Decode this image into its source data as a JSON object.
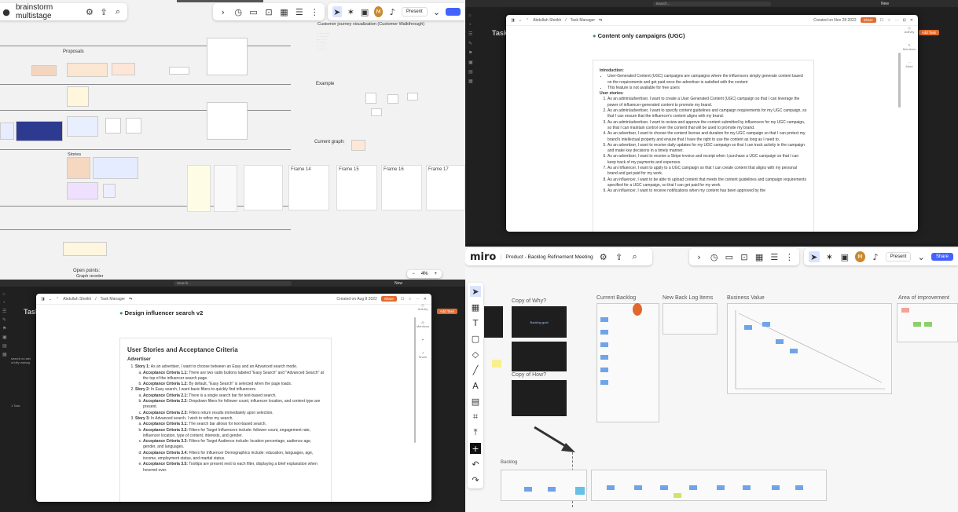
{
  "q1": {
    "board_name": "brainstorm multistage",
    "present_label": "Present",
    "zoom_level": "4%",
    "headings": {
      "proposals": "Proposals",
      "cj_title": "Customer journey visualization (Customer Walkthrough)",
      "example": "Example",
      "current_graph": "Current graph:",
      "open_points": "Open points:",
      "open_points_item": "Graph reorder",
      "stories": "Stories"
    },
    "frames": [
      "Frame 14",
      "Frame 15",
      "Frame 16",
      "Frame 17"
    ],
    "avatar": "M"
  },
  "q2": {
    "search_placeholder": "Search...",
    "new_label": "New",
    "breadcrumb_user": "Abdullah Sheikh",
    "breadcrumb_page": "Task Manager",
    "created": "Created on Nov 28 2022",
    "share": "Share",
    "page_title": "Content only campaigns (UGC)",
    "bg_text": "Task",
    "add_task": "Add Task",
    "intro_heading": "Introduction:",
    "intro_items": [
      "User-Generated Content (UGC) campaigns are campaigns where the influencers simply generate content based on the requirements and get paid once the advertiser is satisfied with the content",
      "This feature is not available for free users"
    ],
    "stories_heading": "User stories:",
    "stories": [
      "As an admin/advertiser, I want to create a User Generated Content (UGC) campaign so that I can leverage the power of influencer-generated content to promote my brand.",
      "As an admin/advertiser, I want to specify content guidelines and campaign requirements for my UGC campaign, so that I can ensure that the influencer's content aligns with my brand.",
      "As an admin/advertiser, I want to review and approve the content submitted by influencers for my UGC campaign, so that I can maintain control over the content that will be used to promote my brand.",
      "As an advertiser, I want to choose the content license and duration for my UGC campaign so that I can protect my brand's intellectual property and ensure that I have the right to use the content as long as I need to.",
      "As an advertiser, I want to receive daily updates for my UGC campaign so that I can track activity in the campaign and make key decisions in a timely manner.",
      "As an advertiser, I want to receive a Stripe invoice and receipt when I purchase a UGC campaign so that I can keep track of my payments and expenses.",
      "As an Influencer, I want to apply to a UGC campaign so that I can create content that aligns with my personal brand and get paid for my work.",
      "As an influencer, I want to be able to upload content that meets the content guidelines and campaign requirements specified for a UGC campaign, so that I can get paid for my work.",
      "As an influencer, I want to receive notifications when my content has been approved by the"
    ],
    "side_labels": [
      "Activity",
      "Mentions",
      "More"
    ]
  },
  "q3": {
    "search_placeholder": "Search...",
    "new_label": "New",
    "breadcrumb_user": "Abdullah Sheikh",
    "breadcrumb_page": "Task Manager",
    "created": "Created on Aug 8 2022",
    "share": "Share",
    "page_title": "Design influencer search v2",
    "bg_text": "Task",
    "bg_snippet": "search on adv a fully manag",
    "add_task": "Add Task",
    "h1": "User Stories and Acceptance Criteria",
    "h2": "Advertiser",
    "stories": [
      {
        "label": "Story 1:",
        "text": "As an advertiser, I want to choose between an Easy and an Advanced search mode.",
        "criteria": [
          {
            "label": "Acceptance Criteria 1.1:",
            "text": "There are two radio buttons labeled \"Easy Search\" and \"Advanced Search\" at the top of the influencer search page."
          },
          {
            "label": "Acceptance Criteria 1.2:",
            "text": "By default, \"Easy Search\" is selected when the page loads."
          }
        ]
      },
      {
        "label": "Story 2:",
        "text": "In Easy search, I want basic filters to quickly find influencers.",
        "criteria": [
          {
            "label": "Acceptance Criteria 2.1:",
            "text": "There is a single search bar for text-based search."
          },
          {
            "label": "Acceptance Criteria 2.2:",
            "text": "Dropdown filters for follower count, influencer location, and content type are present."
          },
          {
            "label": "Acceptance Criteria 2.3:",
            "text": "Filters return results immediately upon selection."
          }
        ]
      },
      {
        "label": "Story 3:",
        "text": "In Advanced search, I wish to refine my search.",
        "criteria": [
          {
            "label": "Acceptance Criteria 3.1:",
            "text": "The search bar allows for text-based search."
          },
          {
            "label": "Acceptance Criteria 3.2:",
            "text": "Filters for Target Influencers include: follower count, engagement rate, influencer location, type of content, interests, and gender."
          },
          {
            "label": "Acceptance Criteria 3.3:",
            "text": "Filters for Target Audience include: location percentage, audience age, gender, and languages."
          },
          {
            "label": "Acceptance Criteria 3.4:",
            "text": "Filters for Influencer Demographics include: education, languages, age, income, employment status, and marital status."
          },
          {
            "label": "Acceptance Criteria 3.5:",
            "text": "Tooltips are present next to each filter, displaying a brief explanation when hovered over."
          }
        ]
      }
    ],
    "side_labels": [
      "Activity",
      "Mentions",
      "Share"
    ],
    "bottom_left": "1 Task"
  },
  "q4": {
    "logo": "miro",
    "board_name": "Product - Backlog Refinement Meeting",
    "present_label": "Present",
    "share_label": "Share",
    "avatar": "M",
    "titles": {
      "copy_why": "Copy of Why?",
      "copy_how": "Copy of How?",
      "current_backlog": "Current Backlog",
      "new_backlog": "New Back Log Items",
      "business_value": "Business Value",
      "area_improvement": "Area of improvement",
      "backlog": "Backlog"
    },
    "block_text": "Backlog goal"
  }
}
